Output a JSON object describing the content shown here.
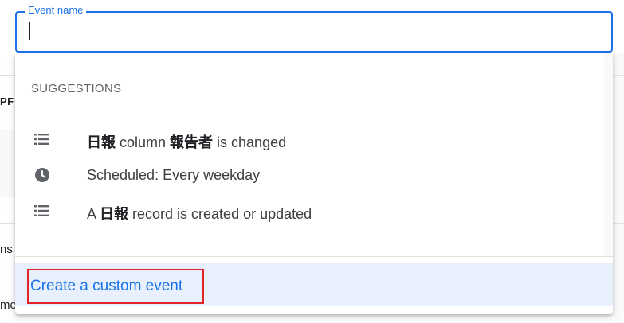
{
  "field": {
    "label": "Event name",
    "value": ""
  },
  "dropdown": {
    "section_heading": "SUGGESTIONS",
    "suggestions": [
      {
        "icon": "list-icon",
        "parts": [
          "",
          "日報",
          " column ",
          "報告者",
          " is changed"
        ]
      },
      {
        "icon": "clock-icon",
        "parts": [
          "Scheduled: Every weekday"
        ]
      },
      {
        "icon": "list-icon",
        "parts": [
          "A ",
          "日報",
          " record is created or updated"
        ]
      }
    ],
    "custom_event_label": "Create a custom event"
  },
  "background": {
    "fragments": [
      "PF",
      "ns",
      "me"
    ]
  },
  "colors": {
    "accent": "#1a73e8",
    "highlight": "#e2232a",
    "custom_row_bg": "#e8f0fe"
  }
}
